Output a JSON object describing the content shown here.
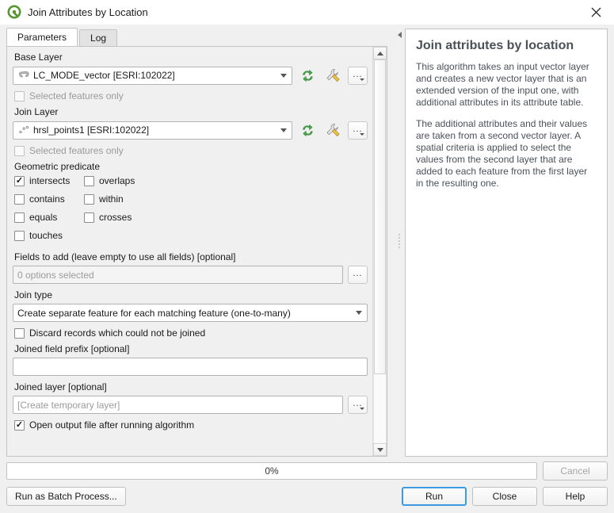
{
  "window": {
    "title": "Join Attributes by Location",
    "logo_icon": "qgis-q-icon",
    "close_icon": "close-icon"
  },
  "tabs": [
    {
      "label": "Parameters",
      "active": true
    },
    {
      "label": "Log",
      "active": false
    }
  ],
  "form": {
    "base_layer": {
      "label": "Base Layer",
      "value": "LC_MODE_vector [ESRI:102022]",
      "layer_icon": "polygon-layer-icon",
      "refresh_icon": "iterate-icon",
      "datadefine_icon": "wrench-icon",
      "browse_label": "...",
      "selected_only_label": "Selected features only",
      "selected_only_checked": false,
      "selected_only_enabled": false
    },
    "join_layer": {
      "label": "Join Layer",
      "value": "hrsl_points1 [ESRI:102022]",
      "layer_icon": "point-layer-icon",
      "refresh_icon": "iterate-icon",
      "datadefine_icon": "wrench-icon",
      "browse_label": "...",
      "selected_only_label": "Selected features only",
      "selected_only_checked": false,
      "selected_only_enabled": false
    },
    "geometric_predicate": {
      "label": "Geometric predicate",
      "options": [
        {
          "label": "intersects",
          "checked": true
        },
        {
          "label": "overlaps",
          "checked": false
        },
        {
          "label": "contains",
          "checked": false
        },
        {
          "label": "within",
          "checked": false
        },
        {
          "label": "equals",
          "checked": false
        },
        {
          "label": "crosses",
          "checked": false
        },
        {
          "label": "touches",
          "checked": false
        }
      ]
    },
    "fields_to_add": {
      "label": "Fields to add (leave empty to use all fields) [optional]",
      "value": "0 options selected",
      "browse_label": "..."
    },
    "join_type": {
      "label": "Join type",
      "value": "Create separate feature for each matching feature (one-to-many)"
    },
    "discard_records": {
      "label": "Discard records which could not be joined",
      "checked": false
    },
    "joined_field_prefix": {
      "label": "Joined field prefix [optional]",
      "value": ""
    },
    "joined_layer": {
      "label": "Joined layer [optional]",
      "value": "[Create temporary layer]",
      "browse_label": "..."
    },
    "open_output": {
      "label": "Open output file after running algorithm",
      "checked": true
    }
  },
  "help": {
    "title": "Join attributes by location",
    "paragraphs": [
      "This algorithm takes an input vector layer and creates a new vector layer that is an extended version of the input one, with additional attributes in its attribute table.",
      "The additional attributes and their values are taken from a second vector layer. A spatial criteria is applied to select the values from the second layer that are added to each feature from the first layer in the resulting one."
    ]
  },
  "footer": {
    "progress_text": "0%",
    "progress_percent": 0,
    "cancel_label": "Cancel",
    "cancel_enabled": false,
    "batch_label": "Run as Batch Process...",
    "run_label": "Run",
    "close_label": "Close",
    "help_label": "Help"
  },
  "colors": {
    "accent": "#3b9ae1",
    "window_bg": "#f0f0f0",
    "panel_bg": "#ffffff",
    "help_text": "#4a5159",
    "qgis_green": "#589632"
  }
}
